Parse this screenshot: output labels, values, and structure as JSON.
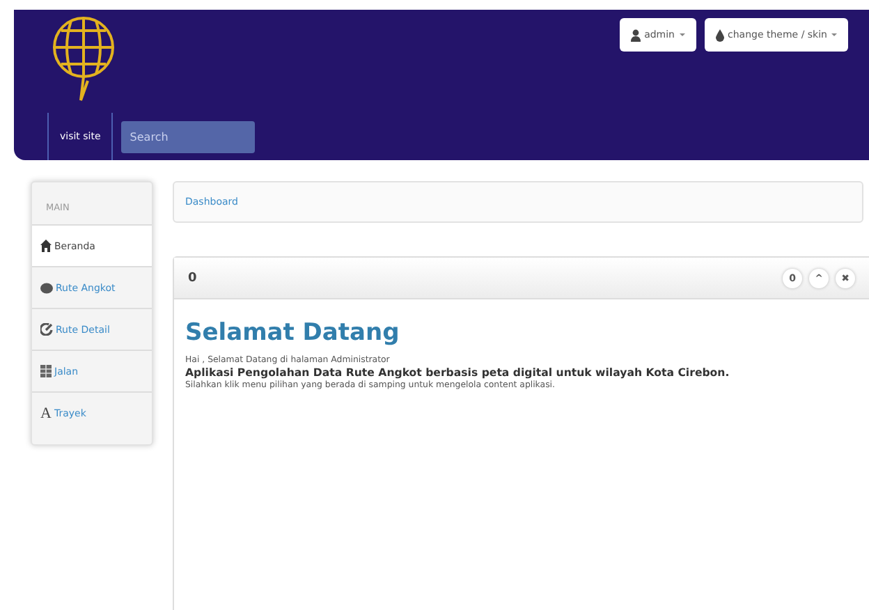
{
  "navbar": {
    "visit_site": "visit site",
    "search": {
      "placeholder": "Search"
    },
    "buttons": [
      {
        "kind": "user",
        "label": "admin"
      },
      {
        "kind": "drop",
        "label": "change theme / skin"
      }
    ]
  },
  "sidebar": {
    "heading": "MAIN",
    "items": [
      {
        "label": "Beranda",
        "selected": true
      },
      {
        "label": "Rute Angkot",
        "selected": false
      },
      {
        "label": "Rute Detail",
        "selected": false
      },
      {
        "label": "Jalan",
        "selected": false
      },
      {
        "glyph": "A",
        "label": "Trayek",
        "selected": false
      }
    ]
  },
  "breadcrumb": "Dashboard",
  "panel": {
    "header_glyph": "0",
    "controls": [
      "0",
      "^",
      "✖"
    ],
    "title": "Selamat Datang",
    "lines": [
      {
        "kind": "small",
        "text": "Hai , Selamat Datang di halaman Administrator"
      },
      {
        "kind": "bold",
        "text": "Aplikasi Pengolahan Data Rute Angkot berbasis peta digital untuk wilayah Kota Cirebon."
      },
      {
        "kind": "small",
        "text": "Silahkan klik menu pilihan yang berada di samping untuk mengelola content aplikasi."
      }
    ]
  }
}
